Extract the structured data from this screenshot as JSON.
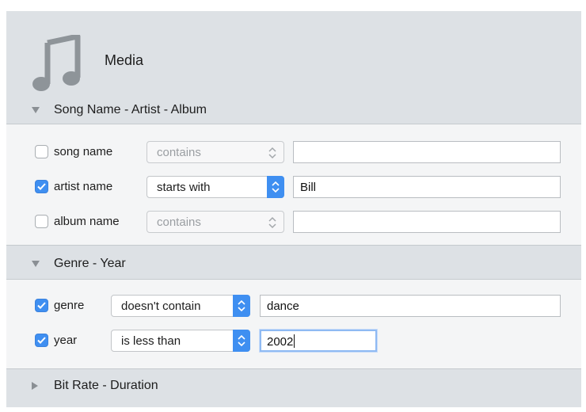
{
  "header": {
    "title": "Media",
    "icon": "music-note-icon"
  },
  "sections": {
    "s1": {
      "label": "Song Name - Artist - Album",
      "expanded": true
    },
    "s2": {
      "label": "Genre - Year",
      "expanded": true
    },
    "s3": {
      "label": "Bit Rate - Duration",
      "expanded": false
    }
  },
  "rows": {
    "song_name": {
      "label": "song name",
      "checked": false,
      "operator": "contains",
      "value": ""
    },
    "artist_name": {
      "label": "artist name",
      "checked": true,
      "operator": "starts with",
      "value": "Bill"
    },
    "album_name": {
      "label": "album name",
      "checked": false,
      "operator": "contains",
      "value": ""
    },
    "genre": {
      "label": "genre",
      "checked": true,
      "operator": "doesn't contain",
      "value": "dance"
    },
    "year": {
      "label": "year",
      "checked": true,
      "operator": "is less than",
      "value": "2002"
    }
  },
  "colors": {
    "accent": "#3f8ff1",
    "panel": "#dde1e5",
    "section_body": "#f4f5f6"
  }
}
